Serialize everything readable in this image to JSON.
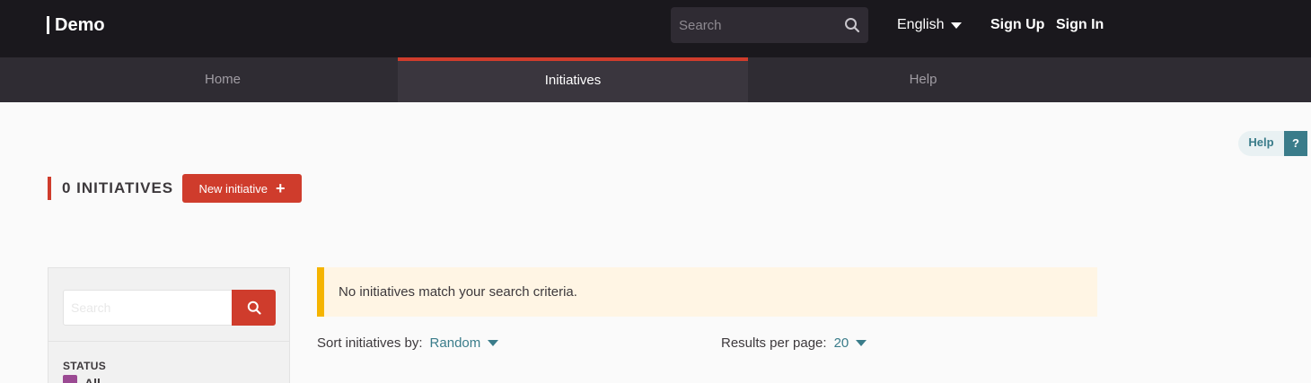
{
  "header": {
    "logo": "Demo",
    "search_placeholder": "Search",
    "language": "English",
    "sign_up": "Sign Up",
    "sign_in": "Sign In"
  },
  "nav": {
    "tabs": [
      {
        "label": "Home",
        "active": false
      },
      {
        "label": "Initiatives",
        "active": true
      },
      {
        "label": "Help",
        "active": false
      }
    ]
  },
  "help_widget": {
    "label": "Help",
    "icon_text": "?"
  },
  "page": {
    "count_title": "0 INITIATIVES",
    "new_button": "New initiative",
    "new_button_icon": "+"
  },
  "filters": {
    "search_placeholder": "Search",
    "status_label": "STATUS",
    "status_all": "All"
  },
  "results": {
    "empty_message": "No initiatives match your search criteria.",
    "sort_label": "Sort initiatives by:",
    "sort_value": "Random",
    "per_page_label": "Results per page:",
    "per_page_value": "20"
  },
  "colors": {
    "accent": "#cf3c2c",
    "topbar": "#1a181d",
    "teal": "#3a7c8a",
    "warning": "#f5b400",
    "status_purple": "#9b4a93"
  }
}
